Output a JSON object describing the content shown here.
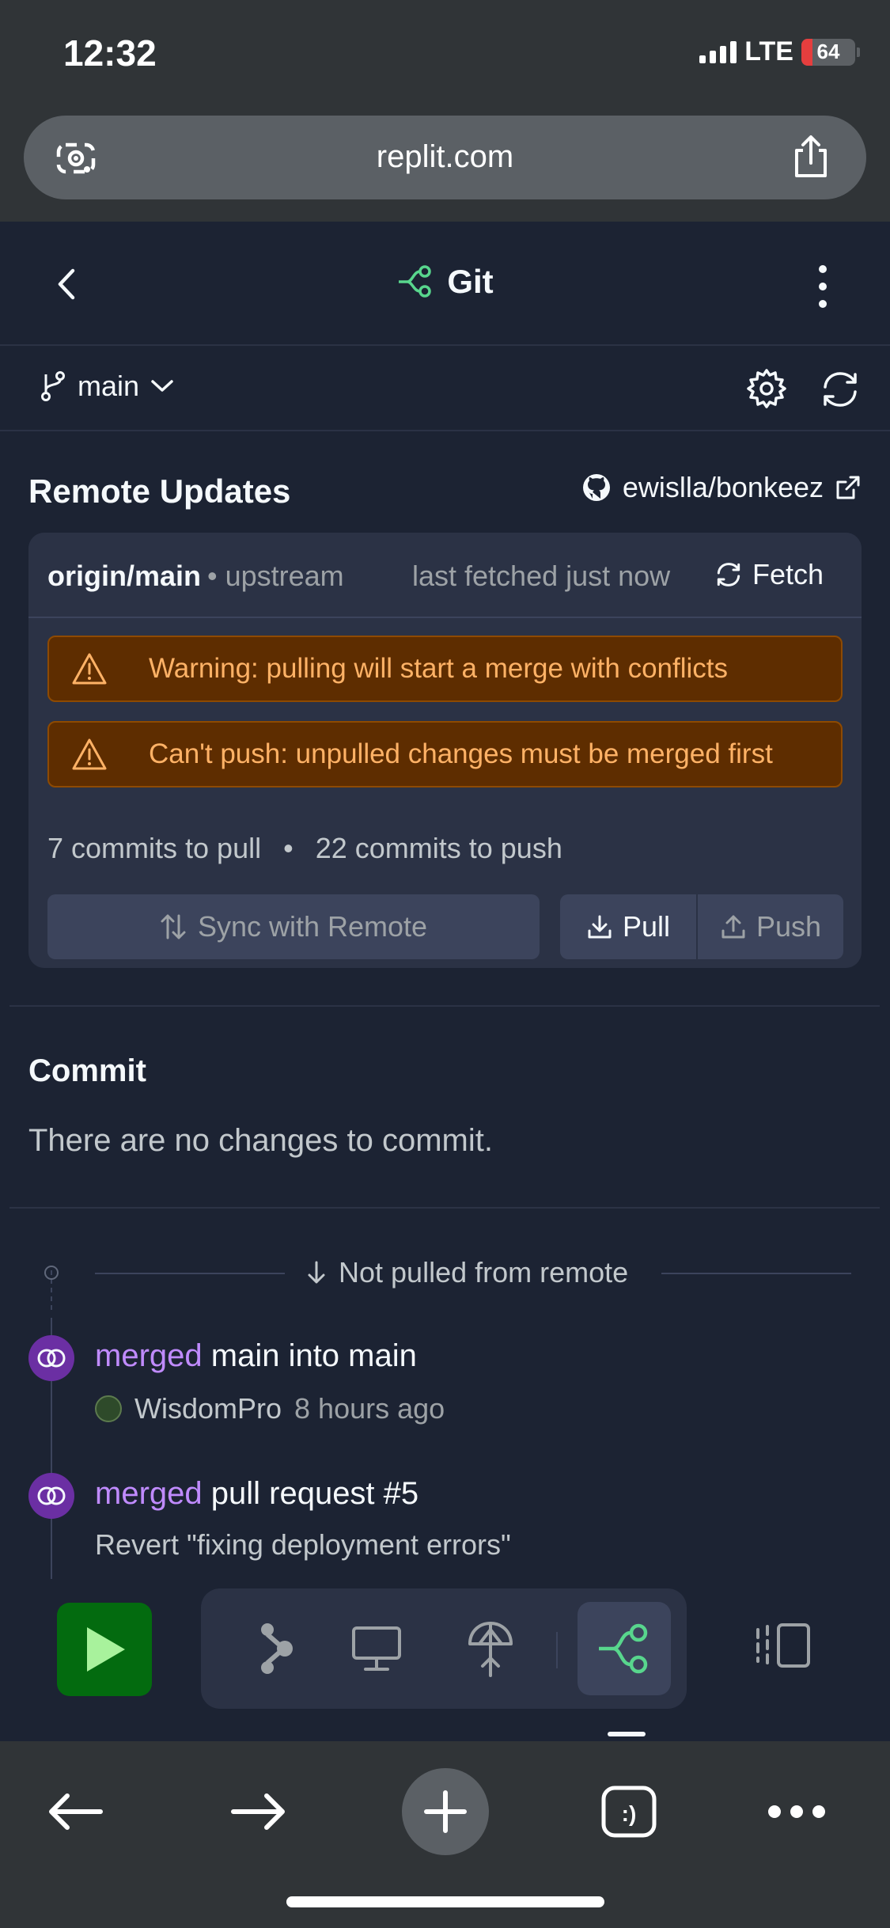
{
  "status_bar": {
    "time": "12:32",
    "network": "LTE",
    "battery": "64"
  },
  "browser": {
    "url": "replit.com"
  },
  "header": {
    "title": "Git"
  },
  "branch": {
    "name": "main"
  },
  "remote": {
    "title": "Remote Updates",
    "repo": "ewislla/bonkeez",
    "origin": "origin/main",
    "upstream": "• upstream",
    "last_fetched": "last fetched just now",
    "fetch_label": "Fetch",
    "warnings": [
      "Warning: pulling will start a merge with conflicts",
      "Can't push: unpulled changes must be merged first"
    ],
    "commits_to_pull": "7 commits to pull",
    "separator": "•",
    "commits_to_push": "22 commits to push",
    "sync_label": "Sync with Remote",
    "pull_label": "Pull",
    "push_label": "Push"
  },
  "commit_section": {
    "title": "Commit",
    "message": "There are no changes to commit."
  },
  "history": {
    "not_pulled_label": "Not pulled from remote",
    "commits": [
      {
        "verb": "merged",
        "text": "main into main",
        "author": "WisdomPro",
        "time": "8 hours ago"
      },
      {
        "verb": "merged",
        "text": "pull request #5",
        "description": "Revert \"fixing deployment errors\""
      }
    ]
  },
  "colors": {
    "background": "#1c2333",
    "accent_green": "#58d68d",
    "run_green": "#036b0f",
    "warning_bg": "#5e2d00",
    "warning_text": "#ffb266",
    "merge_purple": "#c08bff"
  },
  "icons": {
    "url_left": "camera-search-icon",
    "url_right": "share-icon",
    "header_left": "chevron-left-icon",
    "header_title": "git-icon",
    "header_right": "kebab-menu-icon",
    "branch": "git-branch-icon",
    "settings": "gear-icon",
    "refresh": "refresh-icon",
    "repo": "github-icon",
    "external": "external-link-icon",
    "warning": "warning-triangle-icon",
    "dock": [
      "play-icon",
      "workflow-icon",
      "monitor-icon",
      "deploy-icon",
      "git-icon",
      "panel-icon"
    ],
    "safari": [
      "back-arrow-icon",
      "forward-arrow-icon",
      "plus-icon",
      "tabs-icon",
      "more-icon"
    ]
  }
}
